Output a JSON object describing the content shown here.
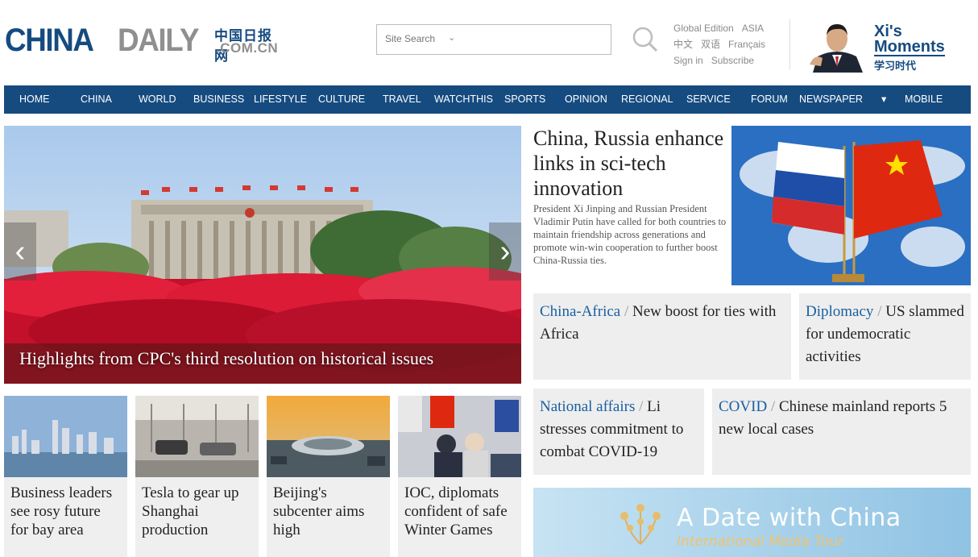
{
  "header": {
    "logo_china": "CHINA",
    "logo_daily": "DAILY",
    "logo_cn": "中国日报网",
    "logo_domain": ".COM.CN",
    "search_placeholder": "Site Search",
    "edition_row1": [
      "Global Edition",
      "ASIA"
    ],
    "edition_row2": [
      "中文",
      "双语",
      "Français"
    ],
    "edition_row3": [
      "Sign in",
      "Subscribe"
    ],
    "xi_line1": "Xi's",
    "xi_line2": "Moments",
    "xi_cn": "学习时代"
  },
  "nav": [
    "HOME",
    "CHINA",
    "WORLD",
    "BUSINESS",
    "LIFESTYLE",
    "CULTURE",
    "TRAVEL",
    "WATCHTHIS",
    "SPORTS",
    "OPINION",
    "REGIONAL",
    "SERVICE",
    "FORUM",
    "NEWSPAPER",
    "▾",
    "MOBILE"
  ],
  "hero": {
    "caption": "Highlights from CPC's third resolution on historical issues",
    "prev": "‹",
    "next": "›"
  },
  "headline": {
    "title": "China, Russia enhance links in sci-tech innovation",
    "summary": "President Xi Jinping and Russian President Vladimir Putin have called for both countries to maintain friendship across generations and promote win-win cooperation to further boost China-Russia ties."
  },
  "topics": [
    {
      "cat": "China-Africa",
      "text": "New boost for ties with Africa"
    },
    {
      "cat": "Diplomacy",
      "text": "US slammed for undemocratic activities"
    },
    {
      "cat": "National affairs",
      "text": "Li stresses commitment to combat COVID-19"
    },
    {
      "cat": "COVID",
      "text": "Chinese mainland reports 5 new local cases"
    }
  ],
  "thumbs": [
    {
      "text": "Business leaders see rosy future for bay area"
    },
    {
      "text": "Tesla to gear up Shanghai production"
    },
    {
      "text": "Beijing's subcenter aims high"
    },
    {
      "text": "IOC, diplomats confident of safe Winter Games"
    }
  ],
  "banner": {
    "title": "A Date with China",
    "subtitle": "International Media Tour"
  },
  "colors": {
    "brand": "#164b80",
    "topic_link": "#1a5fa0",
    "banner_bg": "#d7ecf7"
  }
}
